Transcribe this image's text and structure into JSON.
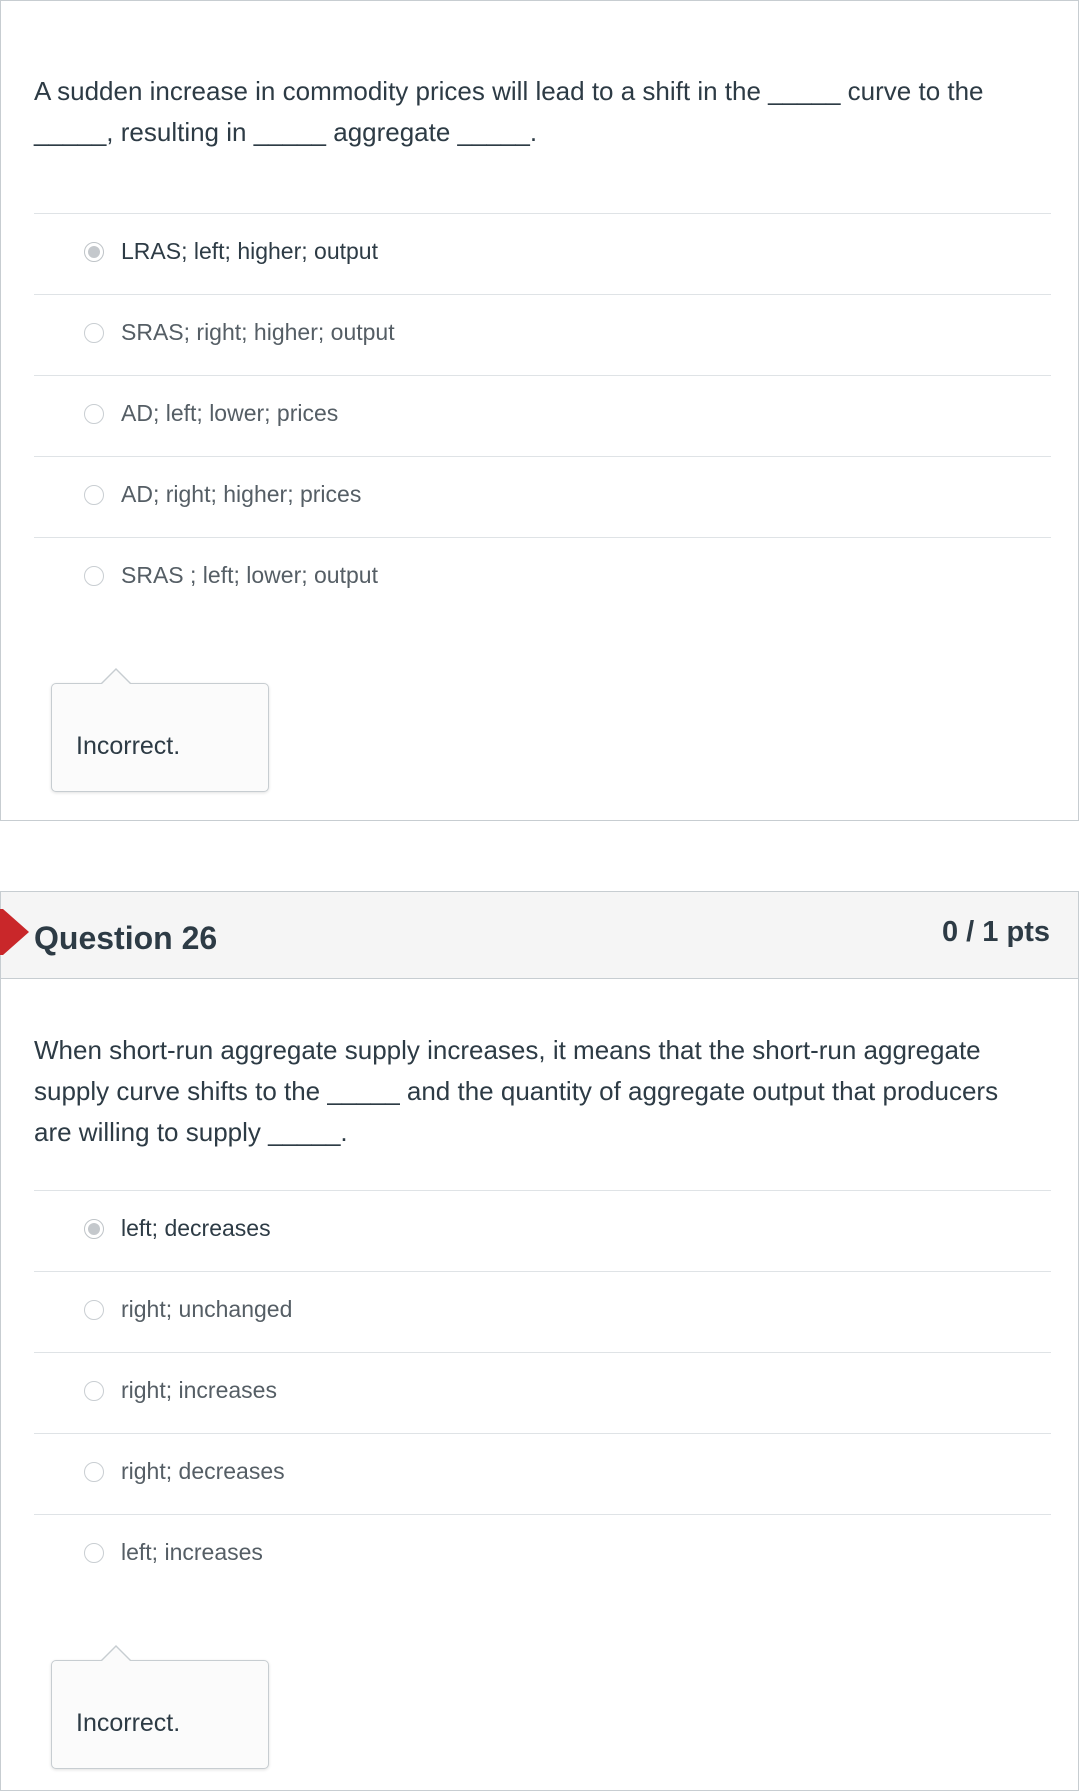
{
  "question_25": {
    "text_line_1": "A sudden increase in commodity prices will lead to a shift in the _____ curve to the",
    "text_line_2": "_____, resulting in _____ aggregate _____.",
    "answers": [
      {
        "label": "LRAS; left; higher; output",
        "selected": true
      },
      {
        "label": "SRAS; right; higher; output",
        "selected": false
      },
      {
        "label": "AD; left; lower; prices",
        "selected": false
      },
      {
        "label": "AD; right; higher; prices",
        "selected": false
      },
      {
        "label": "SRAS ; left; lower; output",
        "selected": false
      }
    ],
    "feedback": "Incorrect."
  },
  "question_26": {
    "title": "Question 26",
    "points": "0 / 1 pts",
    "text_line_1": "When short-run aggregate supply increases, it means that the short-run aggregate",
    "text_line_2": "supply curve shifts to the _____ and the quantity of aggregate output that producers",
    "text_line_3": "are willing to supply _____.",
    "answers": [
      {
        "label": "left; decreases",
        "selected": true
      },
      {
        "label": "right; unchanged",
        "selected": false
      },
      {
        "label": "right; increases",
        "selected": false
      },
      {
        "label": "right; decreases",
        "selected": false
      },
      {
        "label": "left; increases",
        "selected": false
      }
    ],
    "feedback": "Incorrect."
  },
  "colors": {
    "flag": "#c9272a",
    "header_bg": "#f5f5f5",
    "text": "#2d3b45",
    "border": "#c7cdd1"
  },
  "icons": {
    "flag": "incorrect-flag-icon",
    "radio": "radio-button-icon"
  }
}
